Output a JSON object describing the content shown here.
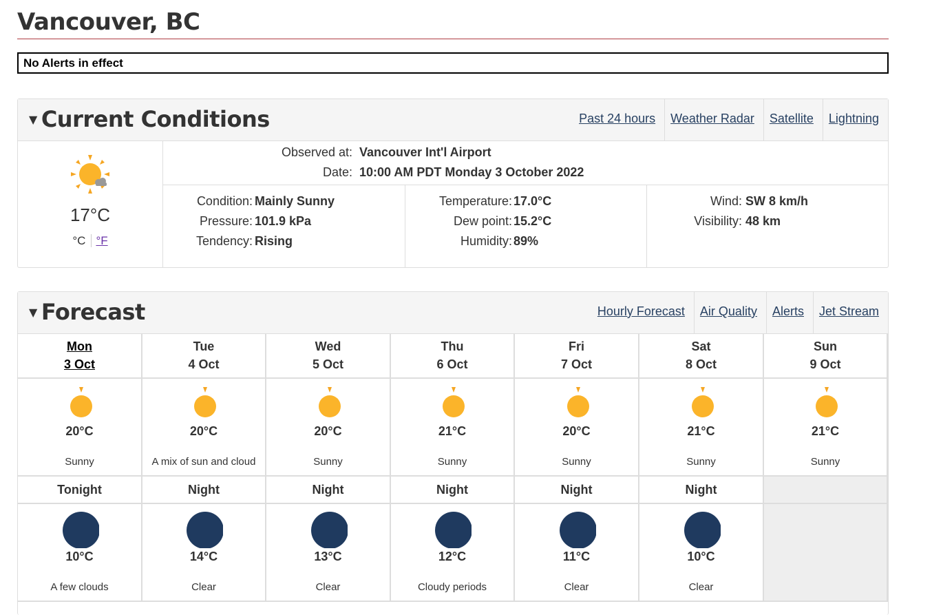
{
  "page": {
    "title": "Vancouver, BC"
  },
  "alerts": {
    "text": "No Alerts in effect"
  },
  "current": {
    "title": "Current Conditions",
    "links": [
      "Past 24 hours",
      "Weather Radar",
      "Satellite",
      "Lightning"
    ],
    "icon": "sun-cloud-icon",
    "temperature": "17°C",
    "unit_c": "°C",
    "unit_f": "°F",
    "observed_label": "Observed at:",
    "observed_value": "Vancouver Int'l Airport",
    "date_label": "Date:",
    "date_value": "10:00 AM PDT Monday 3 October 2022",
    "col1": [
      {
        "label": "Condition:",
        "value": "Mainly Sunny"
      },
      {
        "label": "Pressure:",
        "value": "101.9 kPa"
      },
      {
        "label": "Tendency:",
        "value": "Rising"
      }
    ],
    "col2": [
      {
        "label": "Temperature:",
        "value": "17.0°C"
      },
      {
        "label": "Dew point:",
        "value": "15.2°C"
      },
      {
        "label": "Humidity:",
        "value": "89%"
      }
    ],
    "col3": [
      {
        "label": "Wind:",
        "value": "SW 8 km/h"
      },
      {
        "label": "Visibility:",
        "value": "48 km"
      }
    ]
  },
  "forecast": {
    "title": "Forecast",
    "links": [
      "Hourly Forecast",
      "Air Quality",
      "Alerts",
      "Jet Stream"
    ],
    "days": [
      {
        "name": "Mon",
        "date": "3 Oct",
        "temp": "20°C",
        "cond": "Sunny",
        "icon": "sun-icon"
      },
      {
        "name": "Tue",
        "date": "4 Oct",
        "temp": "20°C",
        "cond": "A mix of sun and cloud",
        "icon": "sun-cloud-icon"
      },
      {
        "name": "Wed",
        "date": "5 Oct",
        "temp": "20°C",
        "cond": "Sunny",
        "icon": "sun-icon"
      },
      {
        "name": "Thu",
        "date": "6 Oct",
        "temp": "21°C",
        "cond": "Sunny",
        "icon": "sun-icon"
      },
      {
        "name": "Fri",
        "date": "7 Oct",
        "temp": "20°C",
        "cond": "Sunny",
        "icon": "sun-icon"
      },
      {
        "name": "Sat",
        "date": "8 Oct",
        "temp": "21°C",
        "cond": "Sunny",
        "icon": "sun-icon"
      },
      {
        "name": "Sun",
        "date": "9 Oct",
        "temp": "21°C",
        "cond": "Sunny",
        "icon": "sun-icon"
      }
    ],
    "nights": [
      {
        "name": "Tonight",
        "temp": "10°C",
        "cond": "A few clouds",
        "icon": "moon-cloud-icon"
      },
      {
        "name": "Night",
        "temp": "14°C",
        "cond": "Clear",
        "icon": "moon-icon"
      },
      {
        "name": "Night",
        "temp": "13°C",
        "cond": "Clear",
        "icon": "moon-icon"
      },
      {
        "name": "Night",
        "temp": "12°C",
        "cond": "Cloudy periods",
        "icon": "moon-cloud-icon"
      },
      {
        "name": "Night",
        "temp": "11°C",
        "cond": "Clear",
        "icon": "moon-icon"
      },
      {
        "name": "Night",
        "temp": "10°C",
        "cond": "Clear",
        "icon": "moon-icon"
      }
    ]
  }
}
